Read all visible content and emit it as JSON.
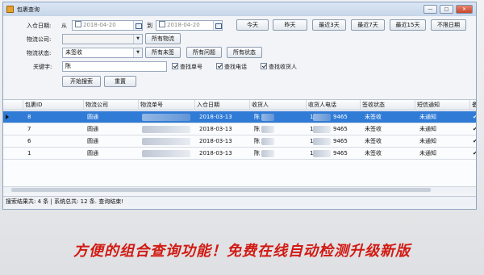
{
  "window": {
    "title": "包裹查询",
    "controls": [
      "—",
      "□",
      "✕"
    ]
  },
  "filters": {
    "date_label": "入仓日期:",
    "from_label": "从",
    "date_from": "2018-04-20",
    "to_label": "到",
    "date_to": "2018-04-20",
    "logistics_label": "物流公司:",
    "logistics_value": "",
    "status_label": "物流状态:",
    "status_value": "未签收",
    "keyword_label": "关键字:",
    "keyword_value": "陈",
    "quick_dates": [
      "今天",
      "昨天",
      "最近3天",
      "最近7天",
      "最近15天",
      "不限日期"
    ],
    "all_logistics": "所有物流",
    "status_buttons": [
      "所有未签",
      "所有问题",
      "所有状态"
    ],
    "checkboxes": [
      "查找单号",
      "查找电话",
      "查找收货人"
    ],
    "search_button": "开始搜索",
    "reset_button": "重置"
  },
  "table": {
    "columns": [
      "包裹ID",
      "物流公司",
      "物流单号",
      "入仓日期",
      "收货人",
      "收货人电话",
      "签收状态",
      "短信通知",
      "备"
    ],
    "rows": [
      {
        "id": "8",
        "company": "圆通",
        "date": "2018-03-13",
        "name": "陈",
        "phone_start": "1",
        "phone_end": "9465",
        "status": "未签收",
        "sms": "未通知",
        "extra": "✔"
      },
      {
        "id": "7",
        "company": "圆通",
        "date": "2018-03-13",
        "name": "陈",
        "phone_start": "1",
        "phone_end": "9465",
        "status": "未签收",
        "sms": "未通知",
        "extra": "✔"
      },
      {
        "id": "6",
        "company": "圆通",
        "date": "2018-03-13",
        "name": "陈",
        "phone_start": "1",
        "phone_end": "9465",
        "status": "未签收",
        "sms": "未通知",
        "extra": "✔"
      },
      {
        "id": "1",
        "company": "圆通",
        "date": "2018-03-13",
        "name": "陈",
        "phone_start": "1",
        "phone_end": "9465",
        "status": "未签收",
        "sms": "未通知",
        "extra": "✔"
      }
    ]
  },
  "status_bar": "搜索结果共: 4 条 | 系统总共: 12 条.    查询结束!",
  "promo": "方便的组合查询功能！免费在线自动检测升级新版",
  "colors": {
    "selection": "#2f7bd6",
    "promo": "#d11a13"
  }
}
